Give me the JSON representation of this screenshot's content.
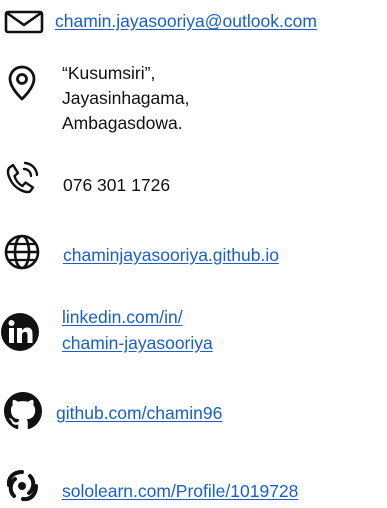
{
  "contact": {
    "email": "chamin.jayasooriya@outlook.com",
    "address": {
      "line1": "“Kusumsiri”,",
      "line2": "Jayasinhagama,",
      "line3": "Ambagasdowa."
    },
    "phone": "076 301 1726",
    "website": "chaminjayasooriya.github.io",
    "linkedin": {
      "line1": "linkedin.com/in/",
      "line2": "chamin-jayasooriya"
    },
    "github": "github.com/chamin96",
    "sololearn": "sololearn.com/Profile/1019728"
  },
  "colors": {
    "link": "#1a5fc8",
    "text": "#111111",
    "icon": "#111111"
  },
  "icons": [
    "envelope-icon",
    "location-pin-icon",
    "phone-icon",
    "globe-icon",
    "linkedin-icon",
    "github-icon",
    "sololearn-icon"
  ]
}
